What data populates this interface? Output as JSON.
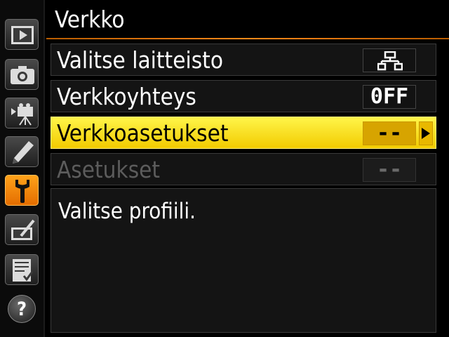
{
  "header": {
    "title": "Verkko"
  },
  "sidebar": {
    "tabs": [
      {
        "icon": "playback-icon",
        "active": false
      },
      {
        "icon": "camera-icon",
        "active": false
      },
      {
        "icon": "movie-icon",
        "active": false
      },
      {
        "icon": "pencil-icon",
        "active": false
      },
      {
        "icon": "wrench-icon",
        "active": true
      },
      {
        "icon": "retouch-icon",
        "active": false
      },
      {
        "icon": "my-menu-icon",
        "active": false
      }
    ],
    "help_label": "?"
  },
  "menu": {
    "items": [
      {
        "label": "Valitse laitteisto",
        "value_icon": "network-icon",
        "state": "normal"
      },
      {
        "label": "Verkkoyhteys",
        "value": "0FF",
        "state": "normal"
      },
      {
        "label": "Verkkoasetukset",
        "value": "--",
        "state": "selected"
      },
      {
        "label": "Asetukset",
        "value": "--",
        "state": "disabled"
      }
    ]
  },
  "help": {
    "text": "Valitse profiili."
  },
  "colors": {
    "highlight": "#f5d800",
    "active_tab": "#f08a00",
    "accent_rule": "#ff8a1a"
  }
}
